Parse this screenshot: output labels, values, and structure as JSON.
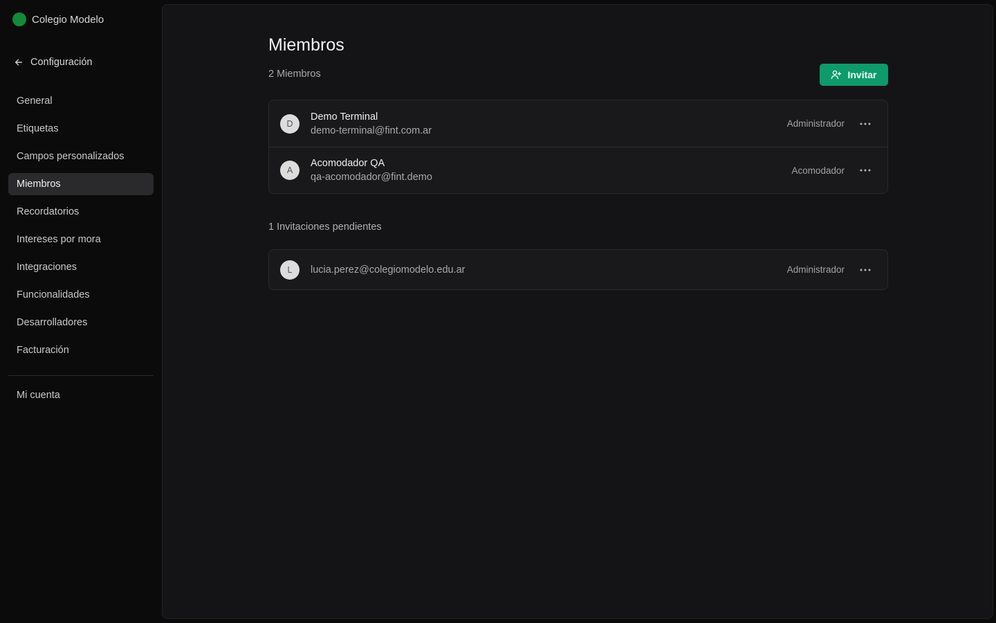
{
  "org": {
    "name": "Colegio Modelo",
    "color": "#138a3a"
  },
  "sidebar": {
    "back_label": "Configuración",
    "items": [
      {
        "label": "General",
        "active": false
      },
      {
        "label": "Etiquetas",
        "active": false
      },
      {
        "label": "Campos personalizados",
        "active": false
      },
      {
        "label": "Miembros",
        "active": true
      },
      {
        "label": "Recordatorios",
        "active": false
      },
      {
        "label": "Intereses por mora",
        "active": false
      },
      {
        "label": "Integraciones",
        "active": false
      },
      {
        "label": "Funcionalidades",
        "active": false
      },
      {
        "label": "Desarrolladores",
        "active": false
      },
      {
        "label": "Facturación",
        "active": false
      }
    ],
    "account_label": "Mi cuenta"
  },
  "page": {
    "title": "Miembros",
    "count_label": "2 Miembros",
    "invite_label": "Invitar",
    "accent": "#0f9a6b"
  },
  "members": [
    {
      "initial": "D",
      "name": "Demo Terminal",
      "email": "demo-terminal@fint.com.ar",
      "role": "Administrador"
    },
    {
      "initial": "A",
      "name": "Acomodador QA",
      "email": "qa-acomodador@fint.demo",
      "role": "Acomodador"
    }
  ],
  "pending": {
    "label": "1 Invitaciones pendientes",
    "items": [
      {
        "initial": "L",
        "email": "lucia.perez@colegiomodelo.edu.ar",
        "role": "Administrador"
      }
    ]
  },
  "icons": {
    "back": "arrow-left-icon",
    "invite": "user-plus-icon",
    "more": "more-horizontal-icon"
  }
}
